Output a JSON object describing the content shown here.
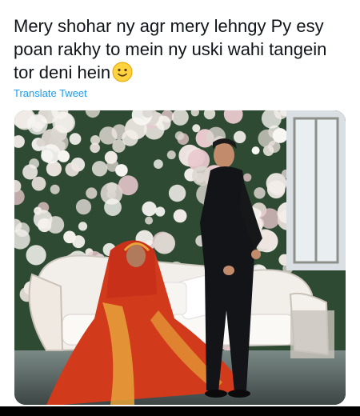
{
  "tweet": {
    "text": "Mery shohar ny agr mery lehngy Py esy poan rakhy to mein ny uski wahi tangein tor deni hein",
    "emoji": "slightly-smiling-face-icon",
    "translate_label": "Translate Tweet"
  },
  "media": {
    "kind": "photo"
  },
  "colors": {
    "text": "#0f1419",
    "link": "#1d9bf0",
    "dress": "#d23a1c"
  }
}
